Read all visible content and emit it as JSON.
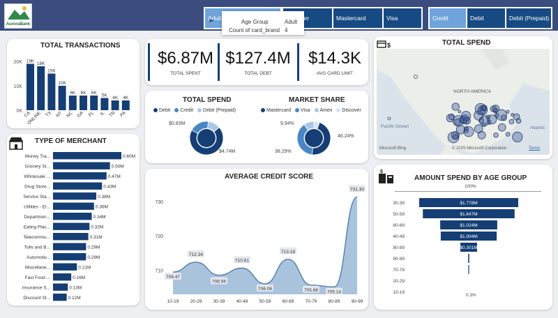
{
  "logo": {
    "name": "AuroraBank"
  },
  "slicers": {
    "age_group": [
      {
        "label": "Adult",
        "active": true
      }
    ],
    "card_brand": [
      {
        "label": "Discover"
      },
      {
        "label": "Mastercard"
      },
      {
        "label": "Visa"
      }
    ],
    "card_type": [
      {
        "label": "Credit"
      },
      {
        "label": "Debit"
      },
      {
        "label": "Debit (Prepaid)"
      }
    ]
  },
  "tooltip": {
    "k1": "Age Group",
    "v1": "Adult",
    "k2": "Count of card_brand",
    "v2": "4"
  },
  "kpis": [
    {
      "value": "$6.87M",
      "label": "TOTAL SPENT"
    },
    {
      "value": "$127.4M",
      "label": "TOTAL DEBT"
    },
    {
      "value": "$14.3K",
      "label": "AVG CARD LIMIT"
    }
  ],
  "total_transactions": {
    "title": "TOTAL TRANSACTIONS"
  },
  "type_of_merchant": {
    "title": "TYPE OF MERCHANT"
  },
  "total_spend_donut": {
    "title": "TOTAL SPEND",
    "legend": [
      "Debit",
      "Credit",
      "Debit (Prepaid)"
    ],
    "label_left": "$0.83M",
    "label_right": "$4.74M"
  },
  "market_share": {
    "title": "MARKET SHARE",
    "legend": [
      "Mastercard",
      "Visa",
      "Amex",
      "Discover"
    ],
    "label_top": "9.94%",
    "label_right": "46.24%",
    "label_left": "38.29%"
  },
  "map": {
    "title": "TOTAL SPEND",
    "labels": {
      "na": "NORTH AMERICA",
      "pacific": "Pacific Ocean",
      "atlantic": "Atlantic",
      "bing": "Microsoft Bing",
      "copy": "© 2025 Microsoft Corporation",
      "terms": "Terms"
    }
  },
  "avg_credit": {
    "title": "AVERAGE CREDIT SCORE"
  },
  "age_group_funnel": {
    "title": "AMOUNT SPEND BY AGE GROUP",
    "top_label": "100%",
    "bottom_label": "0.3%"
  },
  "colors": {
    "navy": "#153e75",
    "mid": "#4a86c5",
    "light": "#a9c8e8",
    "pale": "#d6e4f2"
  },
  "chart_data": [
    {
      "type": "bar",
      "title": "TOTAL TRANSACTIONS",
      "categories": [
        "CA",
        "ONLINE",
        "TX",
        "NY",
        "NC",
        "GA",
        "FL",
        "IL",
        "TN",
        "PA"
      ],
      "values": [
        19,
        18,
        15,
        10,
        6,
        6,
        6,
        5,
        4,
        4
      ],
      "value_labels": [
        "19K",
        "18K",
        "15K",
        "10K",
        "6K",
        "6K",
        "6K",
        "5K",
        "4K",
        "4K"
      ],
      "yticks": [
        "20K",
        "10K",
        "0K"
      ],
      "ylim": [
        0,
        20
      ]
    },
    {
      "type": "bar",
      "title": "TYPE OF MERCHANT",
      "orientation": "horizontal",
      "categories": [
        "Money Tra...",
        "Grocery St...",
        "Wholesale ...",
        "Drug Store...",
        "Service Sta...",
        "Utilities - El...",
        "Departmen...",
        "Eating Plac...",
        "Telecommu...",
        "Tolls and B...",
        "Automotiv...",
        "Miscellane...",
        "Fast Food ...",
        "Insurance S...",
        "Discount St..."
      ],
      "values": [
        0.6,
        0.5,
        0.47,
        0.43,
        0.38,
        0.36,
        0.34,
        0.32,
        0.31,
        0.29,
        0.29,
        0.21,
        0.16,
        0.13,
        0.12
      ],
      "value_labels": [
        "0.60M",
        "0.50M",
        "0.47M",
        "0.43M",
        "0.38M",
        "0.36M",
        "0.34M",
        "0.32M",
        "0.31M",
        "0.29M",
        "0.29M",
        "0.21M",
        "0.16M",
        "0.13M",
        "0.12M"
      ]
    },
    {
      "type": "pie",
      "title": "TOTAL SPEND",
      "categories": [
        "Debit",
        "Credit",
        "Debit (Prepaid)"
      ],
      "values": [
        4.74,
        1.3,
        0.83
      ],
      "colors": [
        "#153e75",
        "#4a86c5",
        "#a9c8e8"
      ]
    },
    {
      "type": "pie",
      "title": "MARKET SHARE",
      "categories": [
        "Mastercard",
        "Visa",
        "Amex",
        "Discover"
      ],
      "values": [
        46.24,
        38.29,
        9.94,
        5.53
      ],
      "colors": [
        "#153e75",
        "#4a86c5",
        "#a9c8e8",
        "#d6e4f2"
      ]
    },
    {
      "type": "area",
      "title": "AVERAGE CREDIT SCORE",
      "categories": [
        "10-19",
        "20-29",
        "30-39",
        "40-49",
        "50-59",
        "60-69",
        "70-79",
        "80-89",
        "90-99"
      ],
      "values": [
        709.47,
        712.34,
        708.56,
        710.61,
        706.06,
        713.18,
        705.68,
        705.14,
        731.3
      ],
      "value_labels": [
        "709.47",
        "712.34",
        "708.56",
        "710.61",
        "706.06",
        "713.18",
        "705.68",
        "705.14",
        "731.30"
      ],
      "yticks": [
        "730",
        "720",
        "710"
      ],
      "ylim": [
        703,
        733
      ]
    },
    {
      "type": "bar",
      "title": "AMOUNT SPEND BY AGE GROUP",
      "orientation": "funnel",
      "categories": [
        "30-39",
        "50-59",
        "60-69",
        "40-49",
        "80-89",
        "90-99",
        "70-79",
        "20-29",
        "10-19"
      ],
      "values": [
        1.778,
        1.647,
        1.024,
        1.004,
        0.301,
        0.02,
        0.01,
        0.0,
        0.0
      ],
      "value_labels": [
        "$1.778M",
        "$1.647M",
        "$1.024M",
        "$1.004M",
        "$0.301M",
        "",
        "",
        "",
        ""
      ]
    }
  ]
}
